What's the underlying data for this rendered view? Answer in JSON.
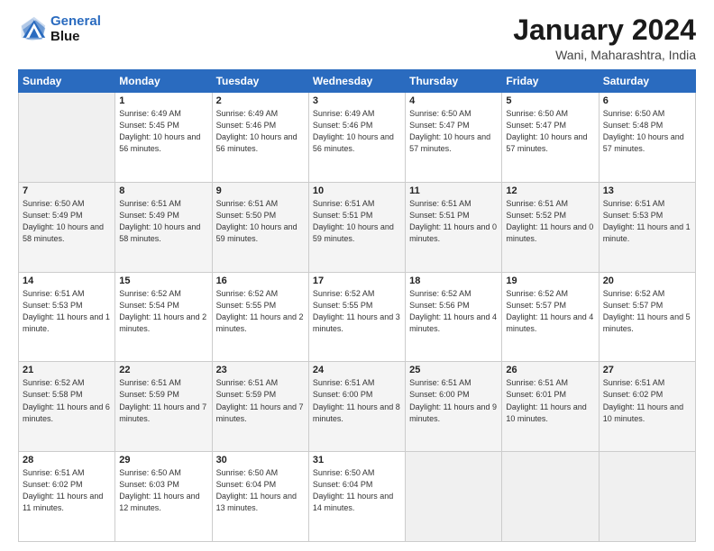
{
  "header": {
    "logo_line1": "General",
    "logo_line2": "Blue",
    "main_title": "January 2024",
    "sub_title": "Wani, Maharashtra, India"
  },
  "calendar": {
    "columns": [
      "Sunday",
      "Monday",
      "Tuesday",
      "Wednesday",
      "Thursday",
      "Friday",
      "Saturday"
    ],
    "weeks": [
      [
        {
          "day": "",
          "info": ""
        },
        {
          "day": "1",
          "info": "Sunrise: 6:49 AM\nSunset: 5:45 PM\nDaylight: 10 hours\nand 56 minutes."
        },
        {
          "day": "2",
          "info": "Sunrise: 6:49 AM\nSunset: 5:46 PM\nDaylight: 10 hours\nand 56 minutes."
        },
        {
          "day": "3",
          "info": "Sunrise: 6:49 AM\nSunset: 5:46 PM\nDaylight: 10 hours\nand 56 minutes."
        },
        {
          "day": "4",
          "info": "Sunrise: 6:50 AM\nSunset: 5:47 PM\nDaylight: 10 hours\nand 57 minutes."
        },
        {
          "day": "5",
          "info": "Sunrise: 6:50 AM\nSunset: 5:47 PM\nDaylight: 10 hours\nand 57 minutes."
        },
        {
          "day": "6",
          "info": "Sunrise: 6:50 AM\nSunset: 5:48 PM\nDaylight: 10 hours\nand 57 minutes."
        }
      ],
      [
        {
          "day": "7",
          "info": "Sunrise: 6:50 AM\nSunset: 5:49 PM\nDaylight: 10 hours\nand 58 minutes."
        },
        {
          "day": "8",
          "info": "Sunrise: 6:51 AM\nSunset: 5:49 PM\nDaylight: 10 hours\nand 58 minutes."
        },
        {
          "day": "9",
          "info": "Sunrise: 6:51 AM\nSunset: 5:50 PM\nDaylight: 10 hours\nand 59 minutes."
        },
        {
          "day": "10",
          "info": "Sunrise: 6:51 AM\nSunset: 5:51 PM\nDaylight: 10 hours\nand 59 minutes."
        },
        {
          "day": "11",
          "info": "Sunrise: 6:51 AM\nSunset: 5:51 PM\nDaylight: 11 hours\nand 0 minutes."
        },
        {
          "day": "12",
          "info": "Sunrise: 6:51 AM\nSunset: 5:52 PM\nDaylight: 11 hours\nand 0 minutes."
        },
        {
          "day": "13",
          "info": "Sunrise: 6:51 AM\nSunset: 5:53 PM\nDaylight: 11 hours\nand 1 minute."
        }
      ],
      [
        {
          "day": "14",
          "info": "Sunrise: 6:51 AM\nSunset: 5:53 PM\nDaylight: 11 hours\nand 1 minute."
        },
        {
          "day": "15",
          "info": "Sunrise: 6:52 AM\nSunset: 5:54 PM\nDaylight: 11 hours\nand 2 minutes."
        },
        {
          "day": "16",
          "info": "Sunrise: 6:52 AM\nSunset: 5:55 PM\nDaylight: 11 hours\nand 2 minutes."
        },
        {
          "day": "17",
          "info": "Sunrise: 6:52 AM\nSunset: 5:55 PM\nDaylight: 11 hours\nand 3 minutes."
        },
        {
          "day": "18",
          "info": "Sunrise: 6:52 AM\nSunset: 5:56 PM\nDaylight: 11 hours\nand 4 minutes."
        },
        {
          "day": "19",
          "info": "Sunrise: 6:52 AM\nSunset: 5:57 PM\nDaylight: 11 hours\nand 4 minutes."
        },
        {
          "day": "20",
          "info": "Sunrise: 6:52 AM\nSunset: 5:57 PM\nDaylight: 11 hours\nand 5 minutes."
        }
      ],
      [
        {
          "day": "21",
          "info": "Sunrise: 6:52 AM\nSunset: 5:58 PM\nDaylight: 11 hours\nand 6 minutes."
        },
        {
          "day": "22",
          "info": "Sunrise: 6:51 AM\nSunset: 5:59 PM\nDaylight: 11 hours\nand 7 minutes."
        },
        {
          "day": "23",
          "info": "Sunrise: 6:51 AM\nSunset: 5:59 PM\nDaylight: 11 hours\nand 7 minutes."
        },
        {
          "day": "24",
          "info": "Sunrise: 6:51 AM\nSunset: 6:00 PM\nDaylight: 11 hours\nand 8 minutes."
        },
        {
          "day": "25",
          "info": "Sunrise: 6:51 AM\nSunset: 6:00 PM\nDaylight: 11 hours\nand 9 minutes."
        },
        {
          "day": "26",
          "info": "Sunrise: 6:51 AM\nSunset: 6:01 PM\nDaylight: 11 hours\nand 10 minutes."
        },
        {
          "day": "27",
          "info": "Sunrise: 6:51 AM\nSunset: 6:02 PM\nDaylight: 11 hours\nand 10 minutes."
        }
      ],
      [
        {
          "day": "28",
          "info": "Sunrise: 6:51 AM\nSunset: 6:02 PM\nDaylight: 11 hours\nand 11 minutes."
        },
        {
          "day": "29",
          "info": "Sunrise: 6:50 AM\nSunset: 6:03 PM\nDaylight: 11 hours\nand 12 minutes."
        },
        {
          "day": "30",
          "info": "Sunrise: 6:50 AM\nSunset: 6:04 PM\nDaylight: 11 hours\nand 13 minutes."
        },
        {
          "day": "31",
          "info": "Sunrise: 6:50 AM\nSunset: 6:04 PM\nDaylight: 11 hours\nand 14 minutes."
        },
        {
          "day": "",
          "info": ""
        },
        {
          "day": "",
          "info": ""
        },
        {
          "day": "",
          "info": ""
        }
      ]
    ]
  }
}
